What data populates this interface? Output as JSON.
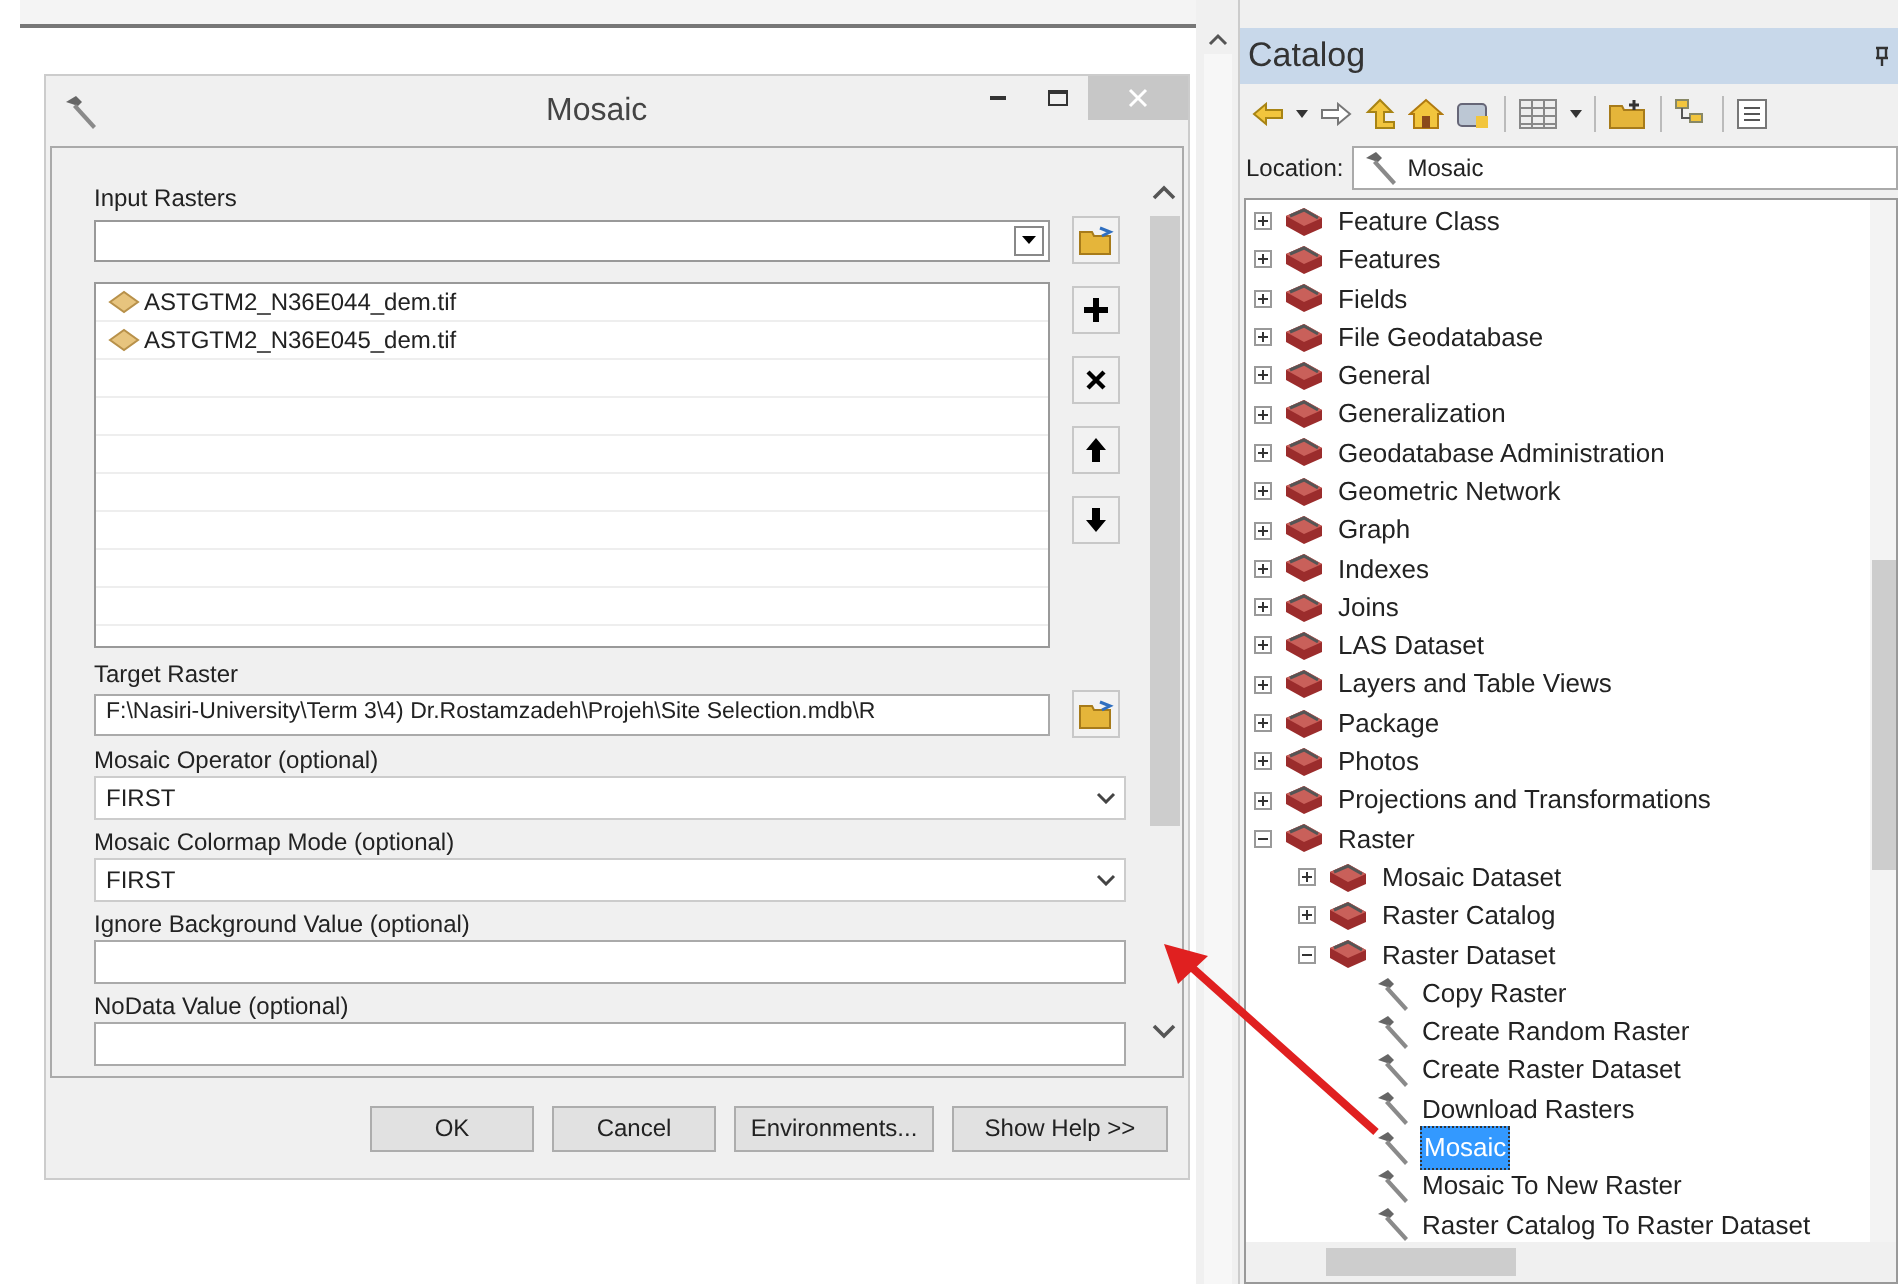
{
  "dialog": {
    "title": "Mosaic",
    "input_rasters": {
      "label": "Input Rasters",
      "items": [
        {
          "text": "ASTGTM2_N36E044_dem.tif"
        },
        {
          "text": "ASTGTM2_N36E045_dem.tif"
        }
      ]
    },
    "target_raster": {
      "label": "Target Raster",
      "value": "F:\\Nasiri-University\\Term 3\\4) Dr.Rostamzadeh\\Projeh\\Site Selection.mdb\\R"
    },
    "params": [
      {
        "kind": "dropdown",
        "label": "Mosaic Operator (optional)",
        "value": "FIRST"
      },
      {
        "kind": "dropdown",
        "label": "Mosaic Colormap Mode (optional)",
        "value": "FIRST"
      },
      {
        "kind": "text",
        "label": "Ignore Background Value (optional)"
      },
      {
        "kind": "text",
        "label": "NoData Value (optional)"
      }
    ],
    "buttons": [
      "OK",
      "Cancel",
      "Environments...",
      "Show Help >>"
    ]
  },
  "catalog": {
    "title": "Catalog",
    "location_label": "Location:",
    "location_value": "Mosaic",
    "tree": [
      {
        "kind": "toolbox",
        "label": "Feature Class",
        "expanded": false,
        "selected": false
      },
      {
        "kind": "toolbox",
        "label": "Features",
        "expanded": false,
        "selected": false
      },
      {
        "kind": "toolbox",
        "label": "Fields",
        "expanded": false,
        "selected": false
      },
      {
        "kind": "toolbox",
        "label": "File Geodatabase",
        "expanded": false,
        "selected": false
      },
      {
        "kind": "toolbox",
        "label": "General",
        "expanded": false,
        "selected": false
      },
      {
        "kind": "toolbox",
        "label": "Generalization",
        "expanded": false,
        "selected": false
      },
      {
        "kind": "toolbox",
        "label": "Geodatabase Administration",
        "expanded": false,
        "selected": false
      },
      {
        "kind": "toolbox",
        "label": "Geometric Network",
        "expanded": false,
        "selected": false
      },
      {
        "kind": "toolbox",
        "label": "Graph",
        "expanded": false,
        "selected": false
      },
      {
        "kind": "toolbox",
        "label": "Indexes",
        "expanded": false,
        "selected": false
      },
      {
        "kind": "toolbox",
        "label": "Joins",
        "expanded": false,
        "selected": false
      },
      {
        "kind": "toolbox",
        "label": "LAS Dataset",
        "expanded": false,
        "selected": false
      },
      {
        "kind": "toolbox",
        "label": "Layers and Table Views",
        "expanded": false,
        "selected": false
      },
      {
        "kind": "toolbox",
        "label": "Package",
        "expanded": false,
        "selected": false
      },
      {
        "kind": "toolbox",
        "label": "Photos",
        "expanded": false,
        "selected": false
      },
      {
        "kind": "toolbox",
        "label": "Projections and Transformations",
        "expanded": false,
        "selected": false
      },
      {
        "kind": "toolbox",
        "label": "Raster",
        "expanded": true,
        "selected": false,
        "children": [
          {
            "kind": "toolbox",
            "label": "Mosaic Dataset",
            "expanded": false,
            "selected": false
          },
          {
            "kind": "toolbox",
            "label": "Raster Catalog",
            "expanded": false,
            "selected": false
          },
          {
            "kind": "toolbox",
            "label": "Raster Dataset",
            "expanded": true,
            "selected": false,
            "children": [
              {
                "kind": "tool",
                "label": "Copy Raster",
                "selected": false
              },
              {
                "kind": "tool",
                "label": "Create Random Raster",
                "selected": false
              },
              {
                "kind": "tool",
                "label": "Create Raster Dataset",
                "selected": false
              },
              {
                "kind": "tool",
                "label": "Download Rasters",
                "selected": false
              },
              {
                "kind": "tool",
                "label": "Mosaic",
                "selected": true
              },
              {
                "kind": "tool",
                "label": "Mosaic To New Raster",
                "selected": false
              },
              {
                "kind": "tool",
                "label": "Raster Catalog To Raster Dataset",
                "selected": false
              }
            ]
          }
        ]
      }
    ]
  }
}
